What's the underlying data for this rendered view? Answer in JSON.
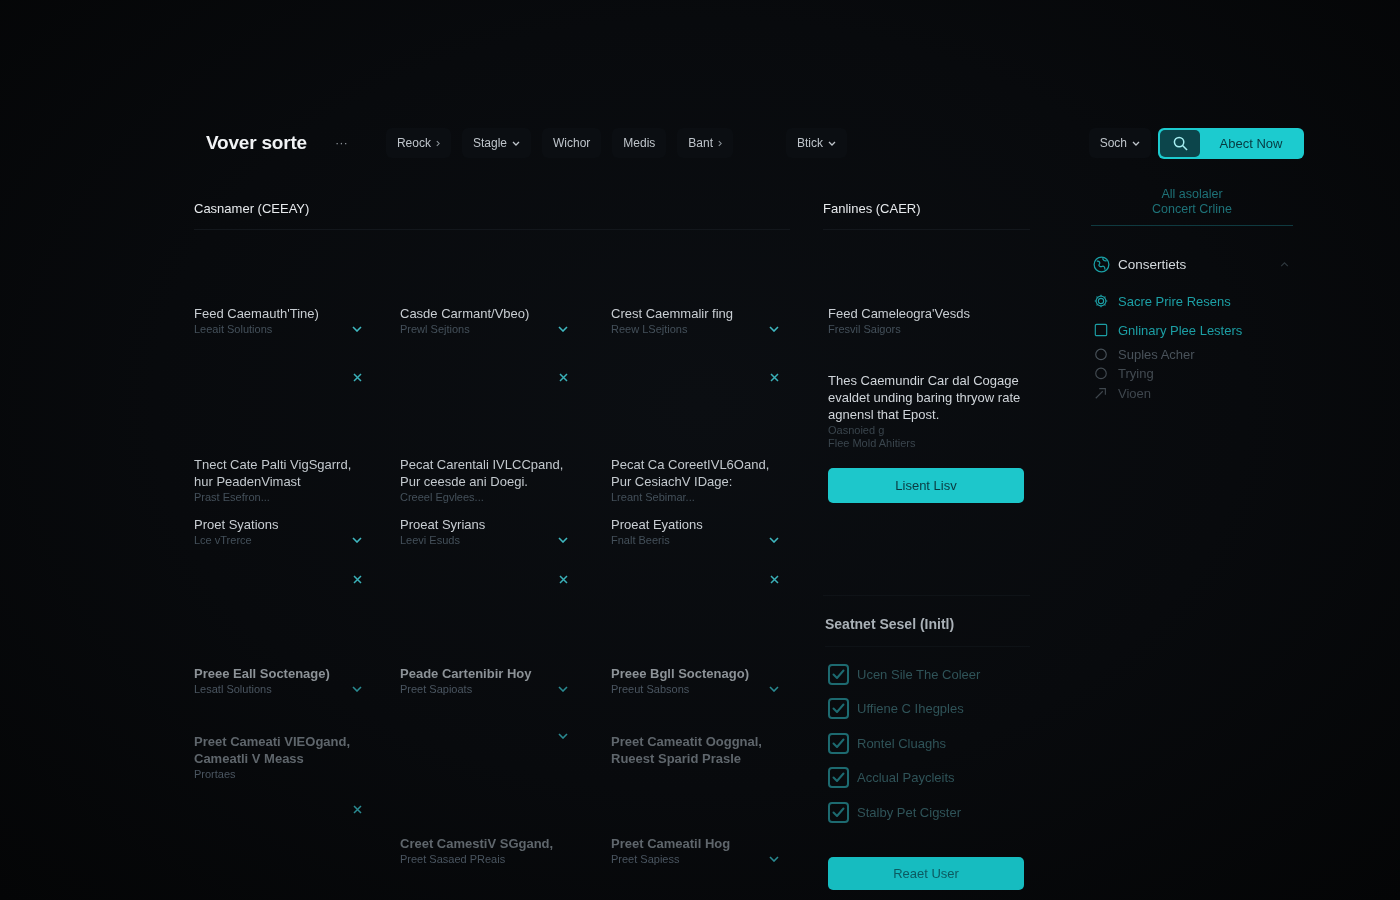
{
  "header": {
    "logo": "Vover sorte",
    "more": "···",
    "nav": [
      {
        "label": "Reock",
        "kind": "submenu"
      },
      {
        "label": "Stagle",
        "kind": "dropdown"
      },
      {
        "label": "Wichor",
        "kind": "link"
      },
      {
        "label": "Medis",
        "kind": "link"
      },
      {
        "label": "Bant",
        "kind": "submenu"
      },
      {
        "label": "Btick",
        "kind": "dropdown"
      }
    ],
    "sort_menu": {
      "label": "Soch",
      "kind": "dropdown"
    },
    "cta": "Abect Now"
  },
  "catalog": {
    "title": "Casnamer (CEEAY)",
    "rows": [
      {
        "cells": [
          {
            "kind": "option",
            "title": "Feed Caemauth'Tine)",
            "subtitle": "Leeait Solutions",
            "expanded": false
          },
          {
            "kind": "option",
            "title": "Casde Carmant/Vbeo)",
            "subtitle": "Prewl Sejtions",
            "expanded": false
          },
          {
            "kind": "option",
            "title": "Crest Caemmalir fing",
            "subtitle": "Reew LSejtions",
            "expanded": false
          }
        ]
      },
      {
        "cells": [
          {
            "kind": "close"
          },
          {
            "kind": "close"
          },
          {
            "kind": "close"
          }
        ]
      },
      {
        "cells": [
          {
            "kind": "note",
            "title": "Tnect Cate Palti VigSgarrd, hur PeadenVimast",
            "subtitle": "Prast Esefron..."
          },
          {
            "kind": "note",
            "title": "Pecat Carentali IVLCCpand, Pur ceesde ani Doegi.",
            "subtitle": "Creeel Egvlees..."
          },
          {
            "kind": "note",
            "title": "Pecat Ca CoreetIVL6Oand, Pur CesiachV IDage:",
            "subtitle": "Lreant Sebimar..."
          }
        ]
      },
      {
        "cells": [
          {
            "kind": "option",
            "title": "Proet Syations",
            "subtitle": "Lce vTrerce",
            "expanded": false
          },
          {
            "kind": "option",
            "title": "Proeat Syrians",
            "subtitle": "Leevi Esuds",
            "expanded": false
          },
          {
            "kind": "option",
            "title": "Proeat Eyations",
            "subtitle": "Fnalt Beeris",
            "expanded": false
          }
        ]
      },
      {
        "cells": [
          {
            "kind": "close"
          },
          {
            "kind": "close"
          },
          {
            "kind": "close"
          }
        ]
      },
      {
        "cells": [
          {
            "kind": "option",
            "title": "Preee Eall Soctenage)",
            "subtitle": "Lesatl Solutions",
            "expanded": false
          },
          {
            "kind": "option",
            "title": "Peade Cartenibir Hoy",
            "subtitle": "Preet Sapioats",
            "expanded": false
          },
          {
            "kind": "option",
            "title": "Preee Bgll Soctenago)",
            "subtitle": "Preeut Sabsons",
            "expanded": false
          }
        ]
      },
      {
        "cells": [
          {
            "kind": "note",
            "title": "Preet Cameati VIEOgand, Cameatli V Meass",
            "subtitle": "Prortaes"
          },
          {
            "kind": "toggle",
            "expanded": false
          },
          {
            "kind": "note",
            "title": "Preet Cameatit Ooggnal, Rueest Sparid Prasle"
          }
        ]
      },
      {
        "cells": [
          {
            "kind": "close"
          },
          {
            "kind": "blank"
          },
          {
            "kind": "blank"
          }
        ]
      },
      {
        "cells": [
          {
            "kind": "blank"
          },
          {
            "kind": "note",
            "title": "Creet CamestiV SGgand,",
            "subtitle": "Preet Sasaed PReais"
          },
          {
            "kind": "option",
            "title": "Preet Cameatil Hog",
            "subtitle": "Preet Sapiess",
            "expanded": false
          }
        ]
      }
    ]
  },
  "details": {
    "title": "Fanlines (CAER)",
    "item_title": "Feed Cameleogra'Vesds",
    "item_subtitle": "Fresvil Saigors",
    "description": "Thes Caemundir Car dal Cogage evaldet unding baring thryow rate agnensl that Epost.",
    "meta": [
      "Oasnoied g",
      "Flee Mold Ahitiers"
    ],
    "button": "Lisent Lisv"
  },
  "settings": {
    "title": "Seatnet Sesel (Initl)",
    "checklist": [
      {
        "label": "Ucen Sile The Coleer",
        "checked": true
      },
      {
        "label": "Uffiene C Ihegples",
        "checked": true
      },
      {
        "label": "Rontel Cluaghs",
        "checked": true
      },
      {
        "label": "Acclual Paycleits",
        "checked": true
      },
      {
        "label": "Stalby Pet Cigster",
        "checked": true
      }
    ],
    "button": "Reaet User"
  },
  "sidebar": {
    "summary": "All asolaler Concert Crline",
    "section": {
      "title": "Consertiets",
      "expanded": true,
      "items": [
        {
          "label": "Sacre Prire Resens",
          "disabled": false
        },
        {
          "label": "Gnlinary Plee Lesters",
          "disabled": false
        },
        {
          "label": "Suples Acher",
          "disabled": true
        },
        {
          "label": "Trying",
          "disabled": true
        },
        {
          "label": "Vioen",
          "disabled": true
        }
      ]
    }
  }
}
